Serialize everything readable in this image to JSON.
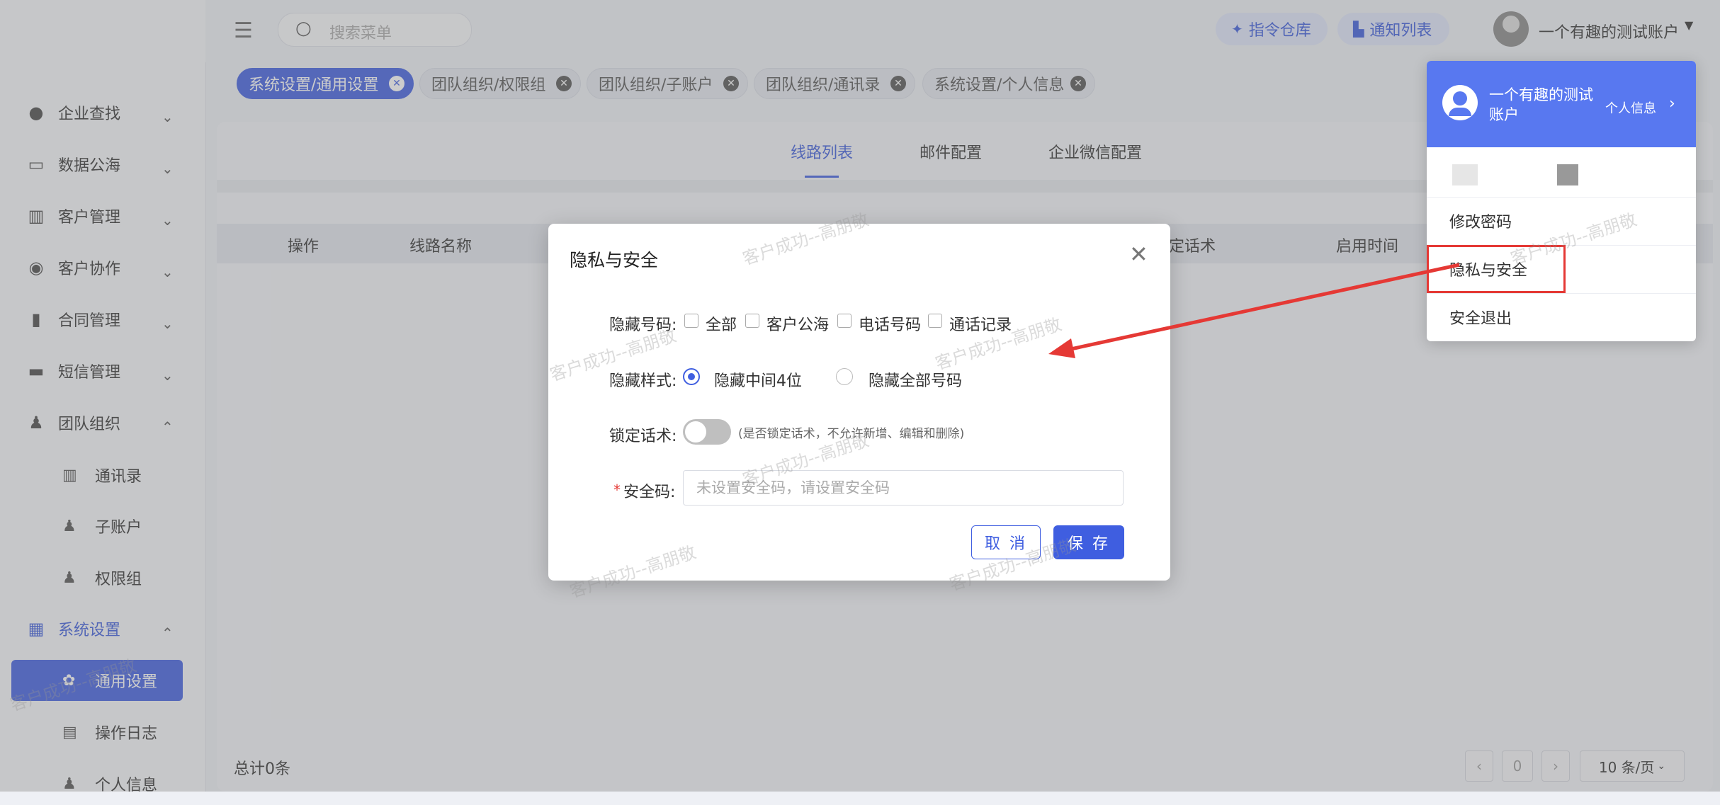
{
  "header": {
    "search_placeholder": "搜索菜单",
    "pill_commands": "指令仓库",
    "pill_notify": "通知列表",
    "account_name": "一个有趣的测试账户"
  },
  "tabs": [
    {
      "label": "系统设置/通用设置"
    },
    {
      "label": "团队组织/权限组"
    },
    {
      "label": "团队组织/子账户"
    },
    {
      "label": "团队组织/通讯录"
    },
    {
      "label": "系统设置/个人信息"
    }
  ],
  "sidebar": {
    "items": [
      {
        "label": "企业查找",
        "icon": "bulb-icon"
      },
      {
        "label": "数据公海",
        "icon": "chart-icon"
      },
      {
        "label": "客户管理",
        "icon": "contacts-icon"
      },
      {
        "label": "客户协作",
        "icon": "collab-icon"
      },
      {
        "label": "合同管理",
        "icon": "clipboard-icon"
      },
      {
        "label": "短信管理",
        "icon": "message-icon"
      },
      {
        "label": "团队组织",
        "icon": "team-icon"
      },
      {
        "label": "系统设置",
        "icon": "dashboard-icon"
      }
    ],
    "team_sub": [
      {
        "label": "通讯录"
      },
      {
        "label": "子账户"
      },
      {
        "label": "权限组"
      }
    ],
    "settings_sub": [
      {
        "label": "通用设置"
      },
      {
        "label": "操作日志"
      },
      {
        "label": "个人信息"
      }
    ]
  },
  "main": {
    "subtabs": [
      "线路列表",
      "邮件配置",
      "企业微信配置"
    ],
    "columns": [
      "操作",
      "线路名称",
      "定话术",
      "启用时间"
    ],
    "total": "总计0条",
    "pagination": {
      "page": "0",
      "page_size": "10 条/页"
    }
  },
  "modal": {
    "title": "隐私与安全",
    "hide_number_label": "隐藏号码:",
    "hide_number_options": [
      "全部",
      "客户公海",
      "电话号码",
      "通话记录"
    ],
    "hide_style_label": "隐藏样式:",
    "hide_style_options": [
      "隐藏中间4位",
      "隐藏全部号码"
    ],
    "lock_label": "锁定话术:",
    "lock_hint": "(是否锁定话术，不允许新增、编辑和删除)",
    "code_label": "安全码:",
    "code_required": "*",
    "code_placeholder": "未设置安全码，请设置安全码",
    "cancel": "取 消",
    "save": "保 存"
  },
  "dropdown": {
    "user_name": "一个有趣的测试账户",
    "profile_link": "个人信息",
    "items": [
      "修改密码",
      "隐私与安全",
      "安全退出"
    ]
  },
  "watermark_text": "客户成功--高朋敬",
  "colors": {
    "accent": "#3f5ee0",
    "annotation": "#e53935"
  }
}
